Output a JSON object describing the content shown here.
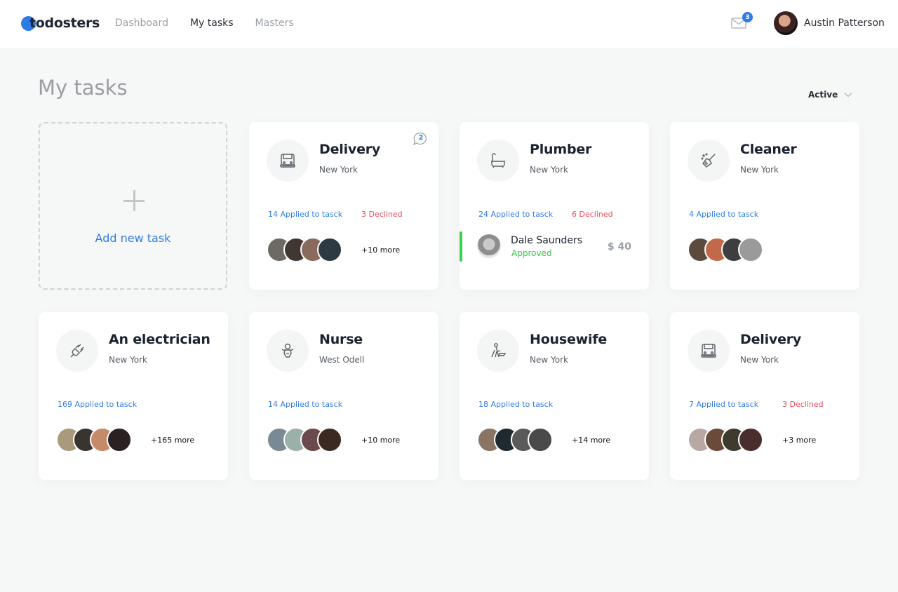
{
  "header": {
    "logo_text": "todosters",
    "nav": [
      "Dashboard",
      "My tasks",
      "Masters"
    ],
    "active_nav": "My tasks",
    "mail_count": "3",
    "user_name": "Austin Patterson"
  },
  "page": {
    "title": "My tasks",
    "filter": "Active",
    "add_label": "Add new task"
  },
  "colors": {
    "accent": "#2f7be6",
    "declined": "#ef4b5f",
    "approved": "#3ac64a"
  },
  "cards": [
    {
      "title": "Delivery",
      "location": "New York",
      "icon": "truck-icon",
      "applied": "14 Applied to tasck",
      "declined": "3 Declined",
      "more": "+10 more",
      "chat_count": "2",
      "avatars": [
        "#6c6a63",
        "#3f3730",
        "#8a6a5c",
        "#2e3a42"
      ]
    },
    {
      "title": "Plumber",
      "location": "New York",
      "icon": "bathtub-icon",
      "applied": "24 Applied to tasck",
      "declined": "6 Declined",
      "approved": {
        "name": "Dale Saunders",
        "status": "Approved",
        "price": "$ 40"
      }
    },
    {
      "title": "Cleaner",
      "location": "New York",
      "icon": "broom-icon",
      "applied": "4 Applied to tasck",
      "avatars": [
        "#5b4a3e",
        "#c06a4a",
        "#3e3e40",
        "#9a9a9a"
      ]
    },
    {
      "title": "An electrician",
      "location": "New York",
      "icon": "plug-icon",
      "applied": "169 Applied to tasck",
      "more": "+165 more",
      "avatars": [
        "#a89a7a",
        "#3a3430",
        "#c48a6a",
        "#2a2222"
      ]
    },
    {
      "title": "Nurse",
      "location": "West Odell",
      "icon": "baby-icon",
      "applied": "14 Applied to tasck",
      "more": "+10 more",
      "avatars": [
        "#7a8a94",
        "#9ab0a8",
        "#6a4a4a",
        "#3a2a22"
      ]
    },
    {
      "title": "Housewife",
      "location": "New York",
      "icon": "ironing-icon",
      "applied": "18 Applied to tasck",
      "more": "+14 more",
      "avatars": [
        "#8a7464",
        "#1e2a30",
        "#5a5a5a",
        "#4a4a4a"
      ]
    },
    {
      "title": "Delivery",
      "location": "New York",
      "icon": "truck-icon",
      "applied": "7 Applied to tasck",
      "declined": "3 Declined",
      "more": "+3 more",
      "avatars": [
        "#b8a8a4",
        "#6a4a3a",
        "#3e3a2e",
        "#4a2e2e"
      ]
    }
  ]
}
